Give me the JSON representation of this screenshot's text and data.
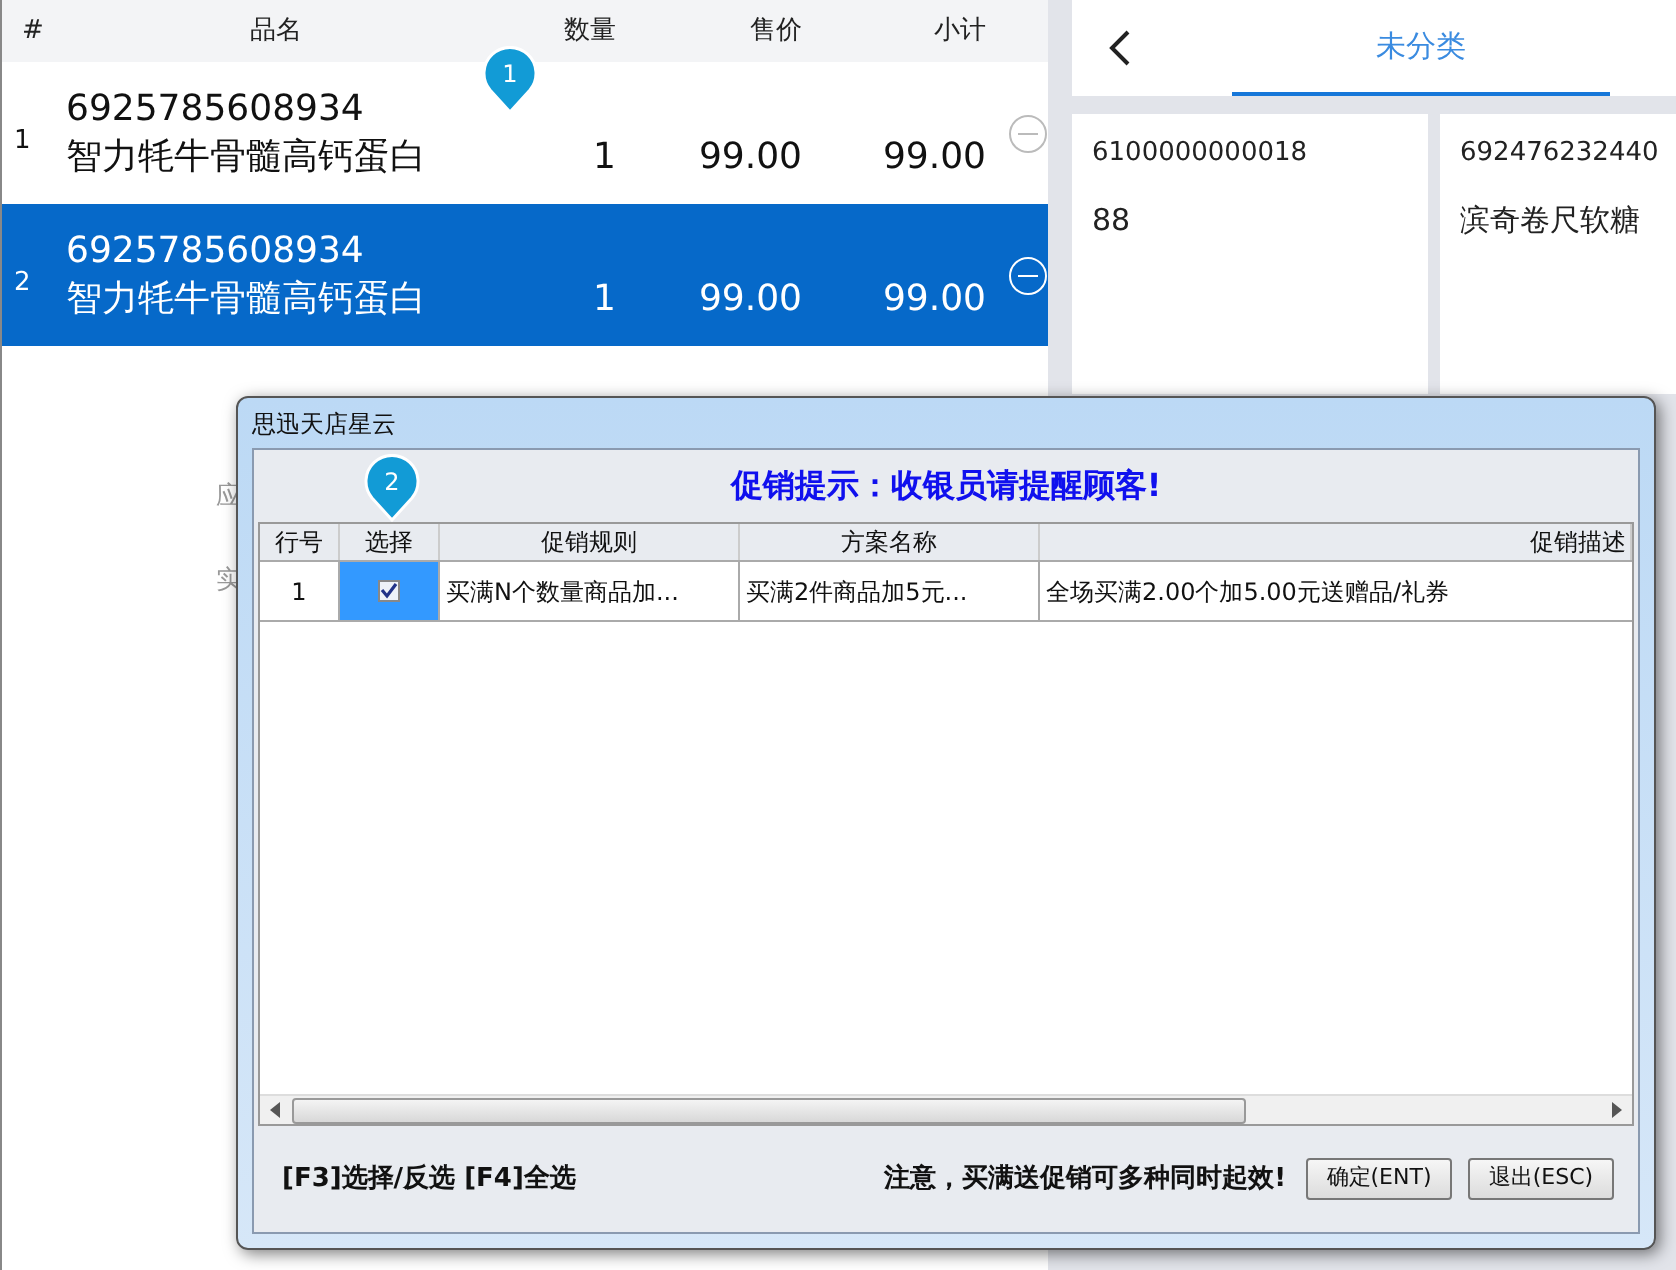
{
  "cart": {
    "columns": [
      "#",
      "品名",
      "数量",
      "售价",
      "小计"
    ],
    "rows": [
      {
        "index": "1",
        "barcode": "6925785608934",
        "name": "智力牦牛骨髓高钙蛋白",
        "qty": "1",
        "price": "99.00",
        "subtotal": "99.00",
        "selected": false
      },
      {
        "index": "2",
        "barcode": "6925785608934",
        "name": "智力牦牛骨髓高钙蛋白",
        "qty": "1",
        "price": "99.00",
        "subtotal": "99.00",
        "selected": true
      }
    ],
    "background_labels": [
      "应",
      "实"
    ]
  },
  "catalog": {
    "tab": "未分类",
    "products": [
      {
        "barcode": "6100000000018",
        "name": "88"
      },
      {
        "barcode": "692476232440",
        "name": "滨奇卷尺软糖"
      }
    ]
  },
  "pins": [
    {
      "label": "1"
    },
    {
      "label": "2"
    }
  ],
  "dialog": {
    "title": "思迅天店星云",
    "banner": "促销提示：收银员请提醒顾客!",
    "columns": [
      "行号",
      "选择",
      "促销规则",
      "方案名称",
      "促销描述"
    ],
    "rows": [
      {
        "no": "1",
        "checked": true,
        "rule": "买满N个数量商品加...",
        "plan": "买满2件商品加5元...",
        "description": "全场买满2.00个加5.00元送赠品/礼券"
      }
    ],
    "hint": "[F3]选择/反选 [F4]全选",
    "notice": "注意，买满送促销可多种同时起效!",
    "buttons": [
      "确定(ENT)",
      "退出(ESC)"
    ]
  }
}
